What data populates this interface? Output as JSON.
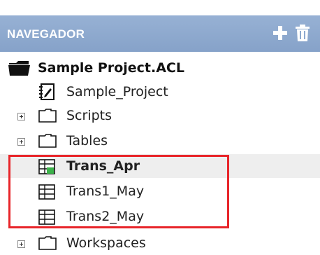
{
  "header": {
    "title": "NAVEGADOR",
    "icons": [
      "plus-icon",
      "trash-icon"
    ]
  },
  "colors": {
    "header_bg": "#8ea9cf",
    "selected_row": "#eeeeee",
    "highlight": "#e8252a",
    "table_green": "#3cb24a"
  },
  "tree": {
    "root": {
      "label": "Sample Project.ACL",
      "icon": "folder-open-icon"
    },
    "items": [
      {
        "label": "Sample_Project",
        "icon": "notebook-icon"
      },
      {
        "label": "Scripts",
        "icon": "folder-icon",
        "expandable": true
      },
      {
        "label": "Tables",
        "icon": "folder-icon",
        "expandable": true
      },
      {
        "label": "Trans_Apr",
        "icon": "table-active-icon",
        "selected": true
      },
      {
        "label": "Trans1_May",
        "icon": "table-icon"
      },
      {
        "label": "Trans2_May",
        "icon": "table-icon"
      },
      {
        "label": "Workspaces",
        "icon": "folder-icon",
        "expandable": true
      }
    ]
  }
}
